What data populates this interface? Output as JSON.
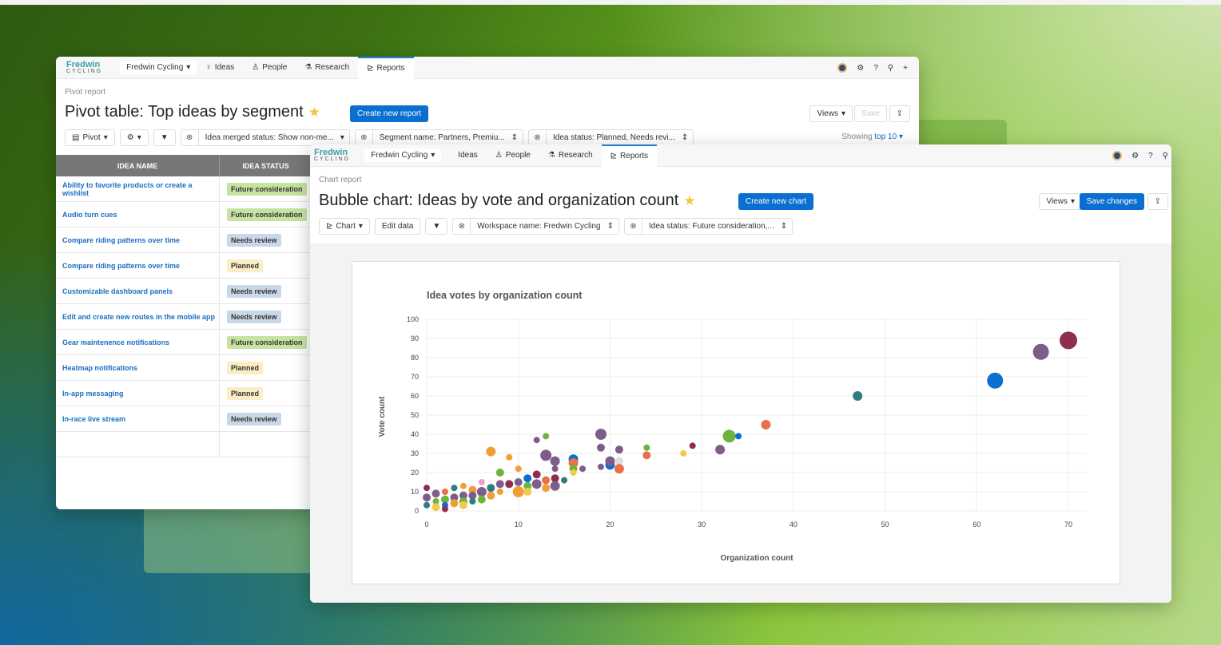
{
  "pivot_window": {
    "nav": {
      "logo_top": "Fredwin",
      "logo_bottom": "CYCLING",
      "workspace": "Fredwin Cycling",
      "items": [
        "Ideas",
        "People",
        "Research",
        "Reports"
      ]
    },
    "breadcrumb": "Pivot report",
    "title": "Pivot table: Top ideas by segment",
    "create_button": "Create new report",
    "views_button": "Views",
    "save_button": "Save",
    "toolbar": {
      "pivot_button": "Pivot",
      "filters": [
        "Idea merged status: Show non-me...",
        "Segment name: Partners, Premiu...",
        "Idea status: Planned, Needs revi..."
      ],
      "showing_prefix": "Showing",
      "showing_value": "top 10"
    },
    "columns": [
      "IDEA NAME",
      "IDEA STATUS"
    ],
    "rows": [
      {
        "name": "Ability to favorite products or create a wishlist",
        "status": "Future consideration"
      },
      {
        "name": "Audio turn cues",
        "status": "Future consideration"
      },
      {
        "name": "Compare riding patterns over time",
        "status": "Needs review"
      },
      {
        "name": "Compare riding patterns over time",
        "status": "Planned"
      },
      {
        "name": "Customizable dashboard panels",
        "status": "Needs review"
      },
      {
        "name": "Edit and create new routes in the mobile app",
        "status": "Needs review"
      },
      {
        "name": "Gear maintenence notifications",
        "status": "Future consideration"
      },
      {
        "name": "Heatmap notifications",
        "status": "Planned"
      },
      {
        "name": "In-app messaging",
        "status": "Planned"
      },
      {
        "name": "In-race live stream",
        "status": "Needs review"
      }
    ],
    "status_colors": {
      "Future consideration": "#c6e3a2",
      "Needs review": "#c9d8e8",
      "Planned": "#fbedc4"
    }
  },
  "chart_window": {
    "nav": {
      "logo_top": "Fredwin",
      "logo_bottom": "CYCLING",
      "workspace": "Fredwin Cycling",
      "items": [
        "Ideas",
        "People",
        "Research",
        "Reports"
      ]
    },
    "breadcrumb": "Chart report",
    "title": "Bubble chart: Ideas by vote and organization count",
    "create_button": "Create new chart",
    "views_button": "Views",
    "save_button": "Save changes",
    "toolbar": {
      "chart_button": "Chart",
      "edit_button": "Edit data",
      "filters": [
        "Workspace name: Fredwin Cycling",
        "Idea status: Future consideration,..."
      ]
    }
  },
  "chart_data": {
    "type": "scatter",
    "title": "Idea votes by organization count",
    "xlabel": "Organization count",
    "ylabel": "Vote count",
    "xlim": [
      0,
      72
    ],
    "ylim": [
      0,
      100
    ],
    "x_ticks": [
      0,
      10,
      20,
      30,
      40,
      50,
      60,
      70
    ],
    "y_ticks": [
      0,
      10,
      20,
      30,
      40,
      50,
      60,
      70,
      80,
      90,
      100
    ],
    "grid": true,
    "points": [
      {
        "x": 70,
        "y": 89,
        "size": 11,
        "color": "#8e2f52"
      },
      {
        "x": 67,
        "y": 83,
        "size": 10,
        "color": "#7e5d8c"
      },
      {
        "x": 62,
        "y": 68,
        "size": 10,
        "color": "#0a6fd0"
      },
      {
        "x": 47,
        "y": 60,
        "size": 6,
        "color": "#2f7b7e"
      },
      {
        "x": 37,
        "y": 45,
        "size": 6,
        "color": "#e8704a"
      },
      {
        "x": 33,
        "y": 39,
        "size": 8,
        "color": "#6cb33f"
      },
      {
        "x": 34,
        "y": 39,
        "size": 4,
        "color": "#0a6fd0"
      },
      {
        "x": 32,
        "y": 32,
        "size": 6,
        "color": "#7e5d8c"
      },
      {
        "x": 29,
        "y": 34,
        "size": 4,
        "color": "#8e2f52"
      },
      {
        "x": 28,
        "y": 30,
        "size": 4,
        "color": "#f2c94c"
      },
      {
        "x": 24,
        "y": 33,
        "size": 4,
        "color": "#6cb33f"
      },
      {
        "x": 24,
        "y": 29,
        "size": 5,
        "color": "#e8704a"
      },
      {
        "x": 21,
        "y": 32,
        "size": 5,
        "color": "#7e5d8c"
      },
      {
        "x": 21,
        "y": 26,
        "size": 5,
        "color": "#dddddd"
      },
      {
        "x": 21,
        "y": 22,
        "size": 6,
        "color": "#e8704a"
      },
      {
        "x": 20,
        "y": 24,
        "size": 6,
        "color": "#0a6fd0"
      },
      {
        "x": 20,
        "y": 26,
        "size": 6,
        "color": "#7e5d8c"
      },
      {
        "x": 19,
        "y": 40,
        "size": 7,
        "color": "#7e5d8c"
      },
      {
        "x": 19,
        "y": 33,
        "size": 5,
        "color": "#7e5d8c"
      },
      {
        "x": 19,
        "y": 23,
        "size": 4,
        "color": "#7e5d8c"
      },
      {
        "x": 17,
        "y": 22,
        "size": 4,
        "color": "#7e5d8c"
      },
      {
        "x": 16,
        "y": 27,
        "size": 6,
        "color": "#0a6fd0"
      },
      {
        "x": 16,
        "y": 25,
        "size": 6,
        "color": "#e8704a"
      },
      {
        "x": 16,
        "y": 22,
        "size": 5,
        "color": "#6cb33f"
      },
      {
        "x": 16,
        "y": 20,
        "size": 4,
        "color": "#f2c94c"
      },
      {
        "x": 15,
        "y": 16,
        "size": 4,
        "color": "#2f7b7e"
      },
      {
        "x": 14,
        "y": 26,
        "size": 6,
        "color": "#7e5d8c"
      },
      {
        "x": 14,
        "y": 22,
        "size": 4,
        "color": "#7e5d8c"
      },
      {
        "x": 14,
        "y": 17,
        "size": 5,
        "color": "#8e2f52"
      },
      {
        "x": 14,
        "y": 13,
        "size": 6,
        "color": "#7e5d8c"
      },
      {
        "x": 13,
        "y": 39,
        "size": 4,
        "color": "#6cb33f"
      },
      {
        "x": 12,
        "y": 37,
        "size": 4,
        "color": "#7e5d8c"
      },
      {
        "x": 13,
        "y": 29,
        "size": 7,
        "color": "#7e5d8c"
      },
      {
        "x": 13,
        "y": 16,
        "size": 5,
        "color": "#e8704a"
      },
      {
        "x": 13,
        "y": 12,
        "size": 5,
        "color": "#f29e38"
      },
      {
        "x": 12,
        "y": 19,
        "size": 5,
        "color": "#8e2f52"
      },
      {
        "x": 12,
        "y": 14,
        "size": 6,
        "color": "#7e5d8c"
      },
      {
        "x": 11,
        "y": 17,
        "size": 5,
        "color": "#0a6fd0"
      },
      {
        "x": 11,
        "y": 13,
        "size": 5,
        "color": "#6cb33f"
      },
      {
        "x": 11,
        "y": 10,
        "size": 5,
        "color": "#f2c94c"
      },
      {
        "x": 10,
        "y": 22,
        "size": 4,
        "color": "#f29e38"
      },
      {
        "x": 10,
        "y": 15,
        "size": 5,
        "color": "#7e5d8c"
      },
      {
        "x": 10,
        "y": 10,
        "size": 7,
        "color": "#f29e38"
      },
      {
        "x": 9,
        "y": 14,
        "size": 5,
        "color": "#8e2f52"
      },
      {
        "x": 9,
        "y": 28,
        "size": 4,
        "color": "#f29e38"
      },
      {
        "x": 8,
        "y": 20,
        "size": 5,
        "color": "#6cb33f"
      },
      {
        "x": 8,
        "y": 14,
        "size": 5,
        "color": "#7e5d8c"
      },
      {
        "x": 8,
        "y": 10,
        "size": 4,
        "color": "#f29e38"
      },
      {
        "x": 7,
        "y": 31,
        "size": 6,
        "color": "#f29e38"
      },
      {
        "x": 7,
        "y": 12,
        "size": 5,
        "color": "#2f7b7e"
      },
      {
        "x": 7,
        "y": 8,
        "size": 5,
        "color": "#f29e38"
      },
      {
        "x": 6,
        "y": 15,
        "size": 4,
        "color": "#e8a0c8"
      },
      {
        "x": 6,
        "y": 10,
        "size": 6,
        "color": "#7e5d8c"
      },
      {
        "x": 6,
        "y": 6,
        "size": 5,
        "color": "#6cb33f"
      },
      {
        "x": 5,
        "y": 11,
        "size": 5,
        "color": "#f29e38"
      },
      {
        "x": 5,
        "y": 8,
        "size": 5,
        "color": "#7e5d8c"
      },
      {
        "x": 5,
        "y": 5,
        "size": 4,
        "color": "#2f7b7e"
      },
      {
        "x": 4,
        "y": 13,
        "size": 4,
        "color": "#f29e38"
      },
      {
        "x": 4,
        "y": 8,
        "size": 5,
        "color": "#7e5d8c"
      },
      {
        "x": 4,
        "y": 5,
        "size": 5,
        "color": "#6cb33f"
      },
      {
        "x": 4,
        "y": 3,
        "size": 5,
        "color": "#f2c94c"
      },
      {
        "x": 3,
        "y": 12,
        "size": 4,
        "color": "#2f7b7e"
      },
      {
        "x": 3,
        "y": 7,
        "size": 5,
        "color": "#7e5d8c"
      },
      {
        "x": 3,
        "y": 4,
        "size": 5,
        "color": "#f29e38"
      },
      {
        "x": 2,
        "y": 10,
        "size": 4,
        "color": "#e8704a"
      },
      {
        "x": 2,
        "y": 6,
        "size": 5,
        "color": "#6cb33f"
      },
      {
        "x": 2,
        "y": 3,
        "size": 4,
        "color": "#0a6fd0"
      },
      {
        "x": 2,
        "y": 1,
        "size": 4,
        "color": "#8e2f52"
      },
      {
        "x": 1,
        "y": 9,
        "size": 5,
        "color": "#7e5d8c"
      },
      {
        "x": 1,
        "y": 5,
        "size": 4,
        "color": "#6cb33f"
      },
      {
        "x": 1,
        "y": 2,
        "size": 5,
        "color": "#f2c94c"
      },
      {
        "x": 0,
        "y": 12,
        "size": 4,
        "color": "#8e2f52"
      },
      {
        "x": 0,
        "y": 7,
        "size": 5,
        "color": "#7e5d8c"
      },
      {
        "x": 0,
        "y": 3,
        "size": 4,
        "color": "#2f7b7e"
      }
    ]
  }
}
